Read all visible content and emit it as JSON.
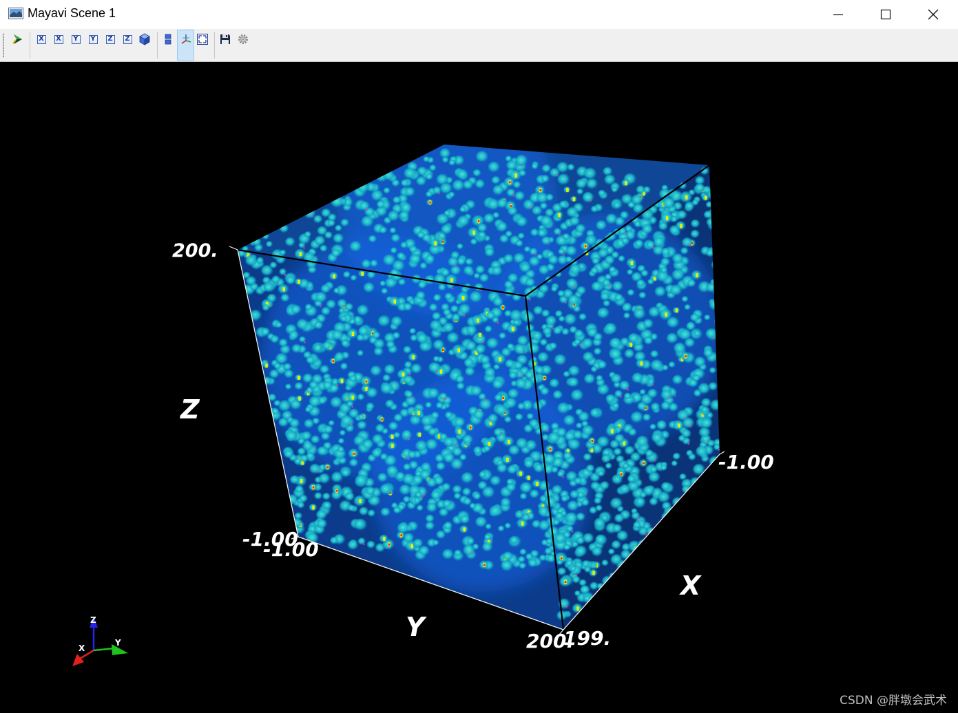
{
  "window": {
    "title": "Mayavi Scene 1",
    "app_icon": "mayavi-scene-icon",
    "controls": {
      "minimize_icon": "minimize-icon",
      "maximize_icon": "maximize-icon",
      "close_icon": "close-icon"
    }
  },
  "toolbar": {
    "buttons": [
      {
        "name": "mayavi-pipeline-icon",
        "glyph": "arrow"
      },
      {
        "name": "view-plus-x-icon",
        "glyph": "X"
      },
      {
        "name": "view-minus-x-icon",
        "glyph": "X"
      },
      {
        "name": "view-plus-y-icon",
        "glyph": "Y"
      },
      {
        "name": "view-minus-y-icon",
        "glyph": "Y"
      },
      {
        "name": "view-plus-z-icon",
        "glyph": "Z"
      },
      {
        "name": "view-minus-z-icon",
        "glyph": "Z"
      },
      {
        "name": "isometric-view-icon",
        "glyph": "cube"
      },
      {
        "name": "parallel-projection-icon",
        "glyph": "bars"
      },
      {
        "name": "toggle-axes-icon",
        "glyph": "axes",
        "active": true
      },
      {
        "name": "full-screen-icon",
        "glyph": "fullscreen"
      },
      {
        "name": "save-icon",
        "glyph": "floppy"
      },
      {
        "name": "configure-scene-icon",
        "glyph": "gear"
      }
    ]
  },
  "scene": {
    "background": "#000000",
    "axes": {
      "z_label": "Z",
      "y_label": "Y",
      "x_label": "X",
      "z_max": "200.",
      "z_min": "-1.00",
      "y_min": "-1.00",
      "y_max": "200.",
      "x_max": "199.",
      "x_min": "-1.00"
    },
    "orientation_axes": {
      "x": "X",
      "y": "Y",
      "z": "Z",
      "x_color": "#e0201c",
      "y_color": "#1fc21f",
      "z_color": "#2424ee"
    },
    "volume_colors": {
      "blob": "#1fd0d0",
      "haze": "#1464e6",
      "hot_yellow": "#e8f000",
      "hot_red": "#ff2020",
      "inner_pink": "#ff3aa0"
    }
  },
  "watermark": "CSDN @胖墩会武术"
}
